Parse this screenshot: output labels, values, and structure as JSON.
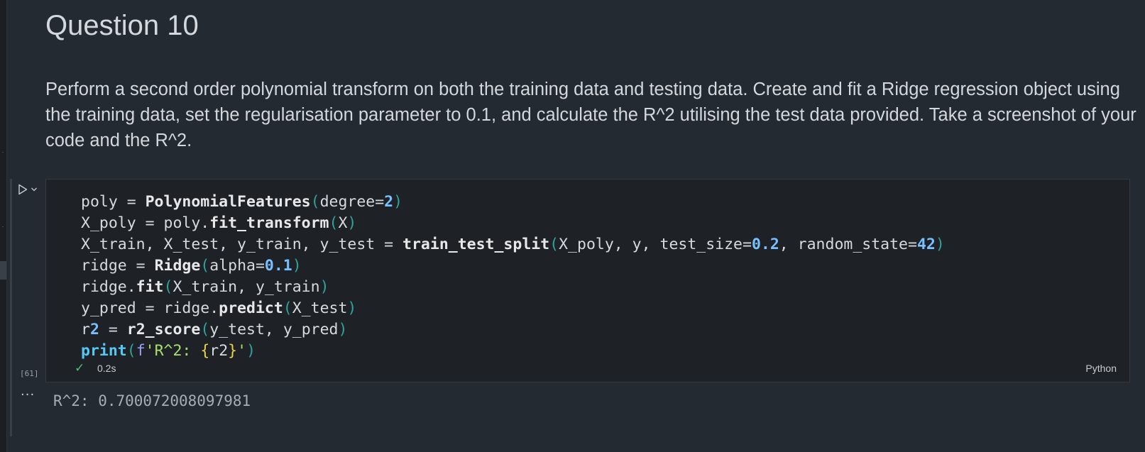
{
  "markdown": {
    "title": "Question 10",
    "paragraph": "Perform a second order polynomial transform on both the training data and testing data. Create and fit a Ridge regression object using the training data, set the regularisation parameter to 0.1, and calculate the R^2 utilising the test data provided. Take a screenshot of your code and the R^2."
  },
  "code_cell": {
    "execution_count": "[61]",
    "status": "0.2s",
    "language": "Python",
    "lines": [
      "poly = PolynomialFeatures(degree=2)",
      "X_poly = poly.fit_transform(X)",
      "X_train, X_test, y_train, y_test = train_test_split(X_poly, y, test_size=0.2, random_state=42)",
      "ridge = Ridge(alpha=0.1)",
      "ridge.fit(X_train, y_train)",
      "y_pred = ridge.predict(X_test)",
      "r2 = r2_score(y_test, y_pred)",
      "print(f'R^2: {r2}')"
    ]
  },
  "output": {
    "ellipsis": "···",
    "text": "R^2: 0.700072008097981"
  },
  "icons": {
    "run": "play-triangle-icon",
    "run_dropdown": "chevron-down-icon",
    "status": "checkmark-icon"
  },
  "colors": {
    "background": "#242a31",
    "code_background": "#1e2227",
    "success": "#4ec27a",
    "number": "#79c0ff",
    "paren": "#2fa39a",
    "string": "#a8e06d",
    "brace": "#e5d34a"
  }
}
